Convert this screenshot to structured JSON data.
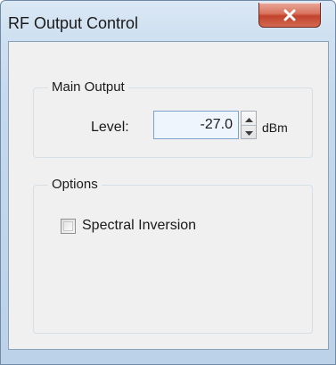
{
  "window": {
    "title": "RF Output Control"
  },
  "main_output": {
    "legend": "Main Output",
    "level_label": "Level:",
    "level_value": "-27.0",
    "unit": "dBm"
  },
  "options": {
    "legend": "Options",
    "spectral_inversion_label": "Spectral Inversion",
    "spectral_inversion_checked": false
  },
  "icons": {
    "close": "close-icon",
    "spin_up": "arrow-up-icon",
    "spin_down": "arrow-down-icon"
  },
  "colors": {
    "close_button": "#c2432c",
    "input_border": "#7da2ce",
    "input_background": "#eef5fd",
    "client_background": "#f0f0f0"
  }
}
